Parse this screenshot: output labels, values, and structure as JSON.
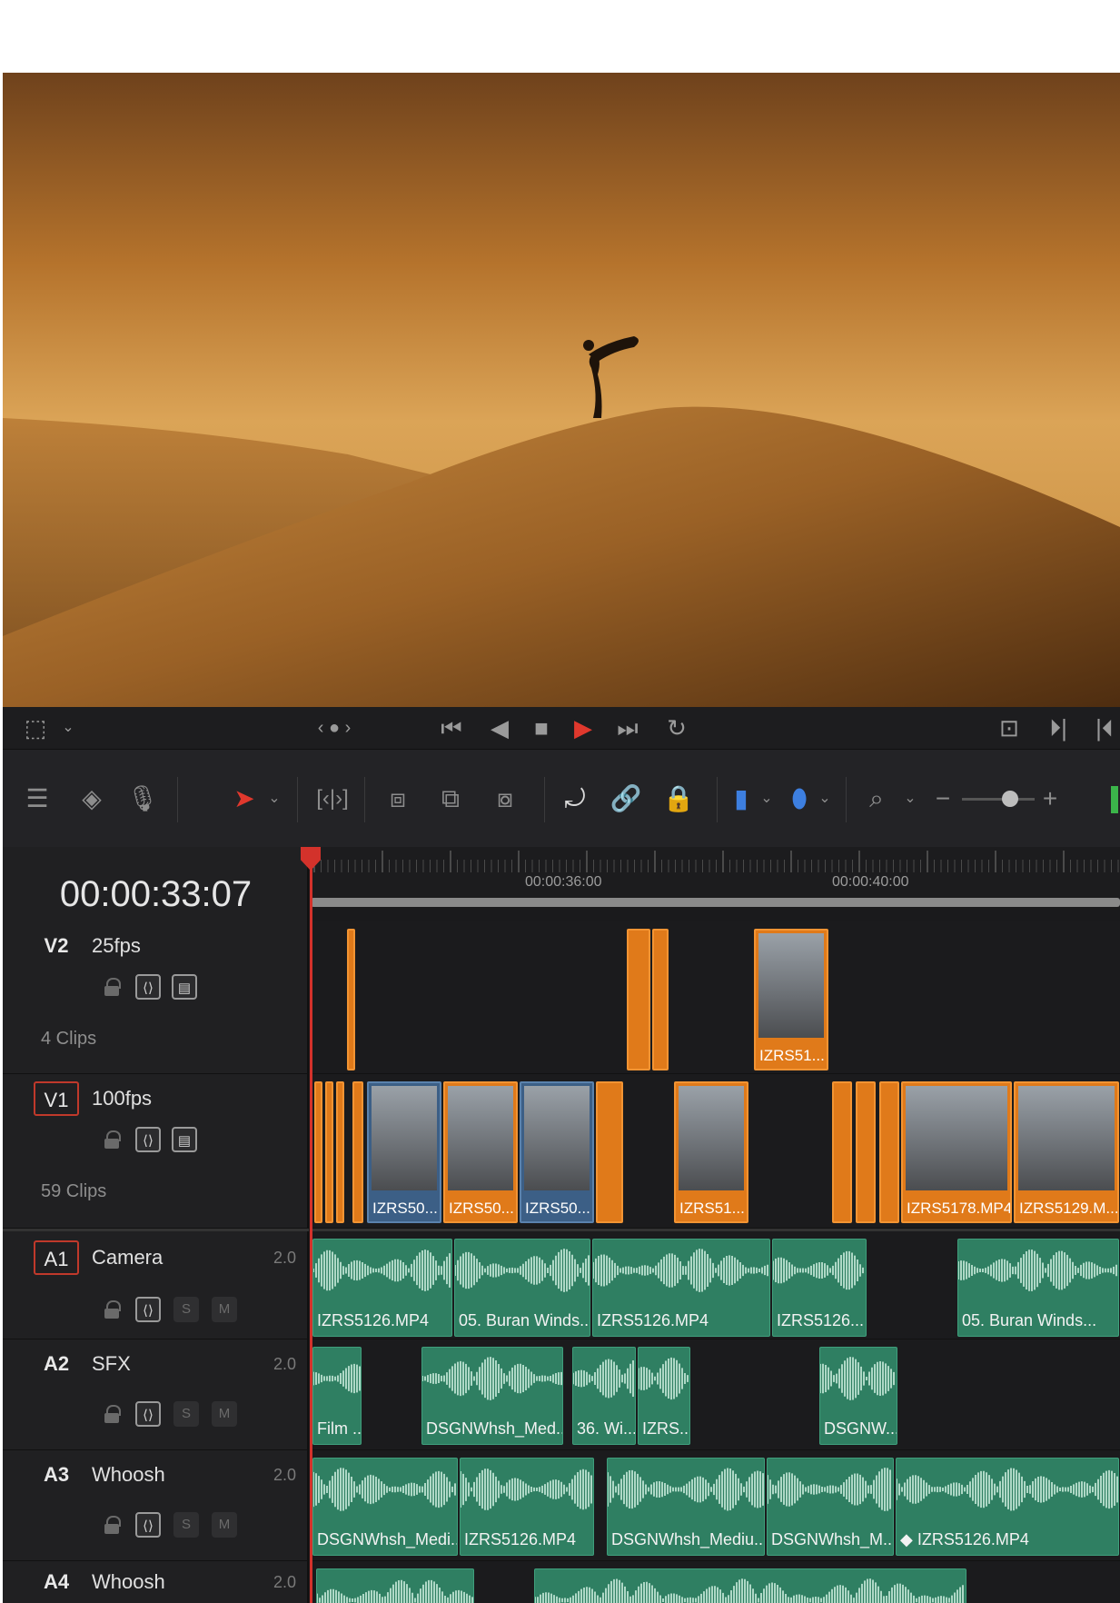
{
  "transport": {
    "icons": [
      "viewer-crop-icon",
      "chevron-down-icon",
      "jog-icon",
      "skip-to-start-icon",
      "play-reverse-icon",
      "stop-icon",
      "play-icon",
      "skip-to-end-icon",
      "loop-icon",
      "match-frame-icon",
      "next-edit-icon",
      "prev-edit-icon"
    ],
    "jog_label": "‹ ● ›"
  },
  "toolbar": {
    "icons": [
      "timeline-view-options-icon",
      "trim-mode-icon",
      "voiceover-icon",
      "selection-arrow-icon",
      "chevron-down-icon",
      "blade-icon",
      "insert-clip-icon",
      "overwrite-clip-icon",
      "replace-clip-icon",
      "snapping-icon",
      "linked-selection-icon",
      "position-lock-icon",
      "flag-icon",
      "marker-icon",
      "zoom-icon",
      "zoom-out-icon",
      "zoom-slider-icon",
      "zoom-in-icon"
    ],
    "zoom_minus": "−",
    "zoom_plus": "+"
  },
  "timeline": {
    "timecode": "00:00:33:07",
    "ruler_labels": [
      "00:00:36:00",
      "00:00:40:00"
    ],
    "tracks": [
      {
        "id": "V2",
        "name": "25fps",
        "clips_count": "4 Clips"
      },
      {
        "id": "V1",
        "name": "100fps",
        "clips_count": "59 Clips"
      },
      {
        "id": "A1",
        "name": "Camera",
        "channels": "2.0",
        "solo": "S",
        "mute": "M"
      },
      {
        "id": "A2",
        "name": "SFX",
        "channels": "2.0",
        "solo": "S",
        "mute": "M"
      },
      {
        "id": "A3",
        "name": "Whoosh",
        "channels": "2.0",
        "solo": "S",
        "mute": "M"
      },
      {
        "id": "A4",
        "name": "Whoosh",
        "channels": "2.0"
      }
    ],
    "v2_clips": [
      {
        "label": "IZRS51..."
      }
    ],
    "v1_clips": [
      {
        "label": "IZRS50..."
      },
      {
        "label": "IZRS50..."
      },
      {
        "label": "IZRS50..."
      },
      {
        "label": "IZRS51..."
      },
      {
        "label": "IZRS5178.MP4"
      },
      {
        "label": "IZRS5129.M..."
      }
    ],
    "a1_clips": [
      "IZRS5126.MP4",
      "05. Buran Winds...",
      "IZRS5126.MP4",
      "IZRS5126...",
      "05. Buran Winds..."
    ],
    "a2_clips": [
      "Film ...",
      "DSGNWhsh_Med...",
      "36. Wi...",
      "IZRS...",
      "DSGNW..."
    ],
    "a3_clips": [
      "DSGNWhsh_Medi...",
      "IZRS5126.MP4",
      "DSGNWhsh_Mediu...",
      "DSGNWhsh_M...",
      "◆  IZRS5126.MP4"
    ],
    "a4_clips": [
      "",
      ""
    ]
  },
  "colors": {
    "video_clip": "#e07a1a",
    "video_clip_blue": "#3c5f86",
    "audio_clip": "#2f7f62",
    "playhead": "#d3322b",
    "active_track_border": "#c0392b"
  }
}
